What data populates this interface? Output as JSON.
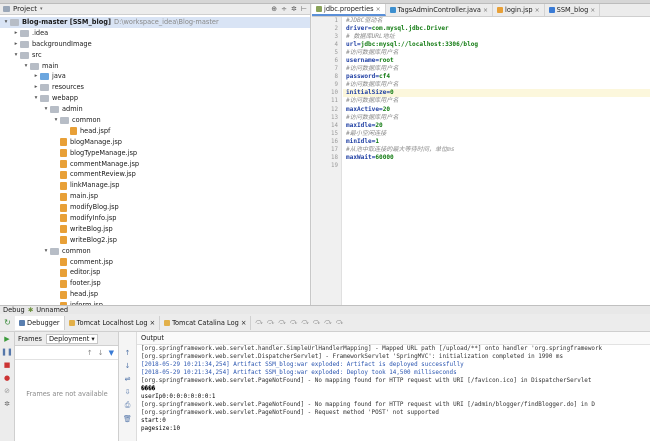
{
  "project": {
    "title": "Project",
    "tree": [
      {
        "label": "Blog-master [SSM_blog]",
        "extra": "D:\\workspace_idea\\Blog-master",
        "indent": 0,
        "arrow": "▾",
        "icon": "folder",
        "bold": true
      },
      {
        "label": ".idea",
        "indent": 1,
        "arrow": "▸",
        "icon": "folder"
      },
      {
        "label": "backgroundImage",
        "indent": 1,
        "arrow": "▸",
        "icon": "folder"
      },
      {
        "label": "src",
        "indent": 1,
        "arrow": "▾",
        "icon": "folder"
      },
      {
        "label": "main",
        "indent": 2,
        "arrow": "▾",
        "icon": "folder"
      },
      {
        "label": "java",
        "indent": 3,
        "arrow": "▸",
        "icon": "src"
      },
      {
        "label": "resources",
        "indent": 3,
        "arrow": "▸",
        "icon": "folder"
      },
      {
        "label": "webapp",
        "indent": 3,
        "arrow": "▾",
        "icon": "folder"
      },
      {
        "label": "admin",
        "indent": 4,
        "arrow": "▾",
        "icon": "folder"
      },
      {
        "label": "common",
        "indent": 5,
        "arrow": "▾",
        "icon": "folder"
      },
      {
        "label": "head.jspf",
        "indent": 6,
        "arrow": "",
        "icon": "jsp"
      },
      {
        "label": "blogManage.jsp",
        "indent": 5,
        "arrow": "",
        "icon": "jsp"
      },
      {
        "label": "blogTypeManage.jsp",
        "indent": 5,
        "arrow": "",
        "icon": "jsp"
      },
      {
        "label": "commentManage.jsp",
        "indent": 5,
        "arrow": "",
        "icon": "jsp"
      },
      {
        "label": "commentReview.jsp",
        "indent": 5,
        "arrow": "",
        "icon": "jsp"
      },
      {
        "label": "linkManage.jsp",
        "indent": 5,
        "arrow": "",
        "icon": "jsp"
      },
      {
        "label": "main.jsp",
        "indent": 5,
        "arrow": "",
        "icon": "jsp"
      },
      {
        "label": "modifyBlog.jsp",
        "indent": 5,
        "arrow": "",
        "icon": "jsp"
      },
      {
        "label": "modifyInfo.jsp",
        "indent": 5,
        "arrow": "",
        "icon": "jsp"
      },
      {
        "label": "writeBlog.jsp",
        "indent": 5,
        "arrow": "",
        "icon": "jsp"
      },
      {
        "label": "writeBlog2.jsp",
        "indent": 5,
        "arrow": "",
        "icon": "jsp"
      },
      {
        "label": "common",
        "indent": 4,
        "arrow": "▾",
        "icon": "folder"
      },
      {
        "label": "comment.jsp",
        "indent": 5,
        "arrow": "",
        "icon": "jsp"
      },
      {
        "label": "editor.jsp",
        "indent": 5,
        "arrow": "",
        "icon": "jsp"
      },
      {
        "label": "footer.jsp",
        "indent": 5,
        "arrow": "",
        "icon": "jsp"
      },
      {
        "label": "head.jsp",
        "indent": 5,
        "arrow": "",
        "icon": "jsp"
      },
      {
        "label": "inform.jsp",
        "indent": 5,
        "arrow": "",
        "icon": "jsp"
      },
      {
        "label": "foreground",
        "indent": 4,
        "arrow": "▸",
        "icon": "folder"
      }
    ]
  },
  "editor": {
    "tabs": [
      {
        "label": "jdbc.properties",
        "active": true,
        "color": "#8aa35a"
      },
      {
        "label": "TagsAdminController.java",
        "active": false,
        "color": "#3c8fcf"
      },
      {
        "label": "login.jsp",
        "active": false,
        "color": "#e8a037"
      },
      {
        "label": "SSM_blog",
        "active": false,
        "color": "#3a7bd5"
      }
    ],
    "lines": [
      {
        "n": "1",
        "type": "com",
        "text": "#JDBC驱动名"
      },
      {
        "n": "2",
        "type": "kv",
        "key": "driver",
        "val": "com.mysql.jdbc.Driver"
      },
      {
        "n": "3",
        "type": "com",
        "text": "# 数据库URL地址"
      },
      {
        "n": "4",
        "type": "kv",
        "key": "url",
        "val": "jdbc:mysql://localhost:3306/blog"
      },
      {
        "n": "5",
        "type": "com",
        "text": "#访问数据库用户名"
      },
      {
        "n": "6",
        "type": "kv",
        "key": "username",
        "val": "root"
      },
      {
        "n": "7",
        "type": "com",
        "text": "#访问数据库用户名"
      },
      {
        "n": "8",
        "type": "kv",
        "key": "password",
        "val": "cf4"
      },
      {
        "n": "9",
        "type": "com",
        "text": "#访问数据库用户名"
      },
      {
        "n": "10",
        "type": "kv",
        "key": "initialSize",
        "val": "0",
        "hl": true
      },
      {
        "n": "11",
        "type": "com",
        "text": "#访问数据库用户名"
      },
      {
        "n": "12",
        "type": "kv",
        "key": "maxActive",
        "val": "20"
      },
      {
        "n": "13",
        "type": "com",
        "text": "#访问数据库用户名"
      },
      {
        "n": "14",
        "type": "kv",
        "key": "maxIdle",
        "val": "20"
      },
      {
        "n": "15",
        "type": "com",
        "text": "#最小空闲连接"
      },
      {
        "n": "16",
        "type": "kv",
        "key": "minIdle",
        "val": "1"
      },
      {
        "n": "17",
        "type": "com",
        "text": "#从池中取连接的最大等待时间，单位ms"
      },
      {
        "n": "18",
        "type": "kv",
        "key": "maxWait",
        "val": "60000"
      },
      {
        "n": "19",
        "type": "blank"
      }
    ]
  },
  "debug": {
    "title": "Debug",
    "config": "Unnamed",
    "tabs": [
      "Debugger",
      "Tomcat Localhost Log",
      "Tomcat Catalina Log"
    ],
    "frames_label": "Frames",
    "deployment_label": "Deployment",
    "frames_empty": "Frames are not available",
    "output_label": "Output",
    "output": [
      {
        "style": "gray",
        "text": "[org.springframework.web.servlet.handler.SimpleUrlHandlerMapping] - Mapped URL path [/upload/**] onto handler 'org.springframework"
      },
      {
        "style": "gray",
        "text": "[org.springframework.web.servlet.DispatcherServlet] - FrameworkServlet 'SpringMVC': initialization completed in 1990 ms"
      },
      {
        "style": "blue",
        "text": "[2018-05-29 10:21:34,254] Artifact SSM_blog:war exploded: Artifact is deployed successfully"
      },
      {
        "style": "blue",
        "text": "[2018-05-29 10:21:34,254] Artifact SSM_blog:war exploded: Deploy took 14,500 milliseconds"
      },
      {
        "style": "gray",
        "text": "[org.springframework.web.servlet.PageNotFound] - No mapping found for HTTP request with URI [/favicon.ico] in DispatcherServlet"
      },
      {
        "style": "black",
        "text": "����"
      },
      {
        "style": "black",
        "text": "userIp0:0:0:0:0:0:0:1"
      },
      {
        "style": "gray",
        "text": "[org.springframework.web.servlet.PageNotFound] - No mapping found for HTTP request with URI [/admin/blogger/findBlogger.do] in D"
      },
      {
        "style": "gray",
        "text": "[org.springframework.web.servlet.PageNotFound] - Request method 'POST' not supported"
      },
      {
        "style": "black",
        "text": "start:0"
      },
      {
        "style": "black",
        "text": "pagesize:10"
      }
    ]
  }
}
